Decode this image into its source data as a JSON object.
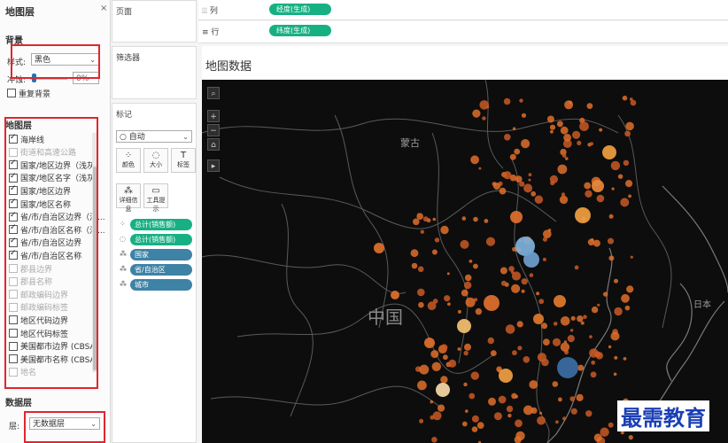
{
  "left_panel": {
    "title": "地图层",
    "close": "×",
    "background": {
      "heading": "背景",
      "style_label": "样式:",
      "style_value": "黑色",
      "wash_label": "冲蚀:",
      "wash_value": "0%",
      "repeat_label": "重复背景"
    },
    "layers": {
      "heading": "地图层",
      "items": [
        {
          "label": "海岸线",
          "checked": true,
          "enabled": true
        },
        {
          "label": "街道和高速公路",
          "checked": false,
          "enabled": false
        },
        {
          "label": "国家/地区边界（浅灰）",
          "checked": true,
          "enabled": true
        },
        {
          "label": "国家/地区名字（浅灰）",
          "checked": true,
          "enabled": true
        },
        {
          "label": "国家/地区边界",
          "checked": true,
          "enabled": true
        },
        {
          "label": "国家/地区名称",
          "checked": true,
          "enabled": true
        },
        {
          "label": "省/市/自治区边界（浅...",
          "checked": true,
          "enabled": true
        },
        {
          "label": "省/市/自治区名称（浅...",
          "checked": true,
          "enabled": true
        },
        {
          "label": "省/市/自治区边界",
          "checked": true,
          "enabled": true
        },
        {
          "label": "省/市/自治区名称",
          "checked": true,
          "enabled": true
        },
        {
          "label": "郡县边界",
          "checked": false,
          "enabled": false
        },
        {
          "label": "郡县名称",
          "checked": false,
          "enabled": false
        },
        {
          "label": "邮政编码边界",
          "checked": false,
          "enabled": false
        },
        {
          "label": "邮政编码标签",
          "checked": false,
          "enabled": false
        },
        {
          "label": "地区代码边界",
          "checked": false,
          "enabled": true
        },
        {
          "label": "地区代码标签",
          "checked": false,
          "enabled": true
        },
        {
          "label": "美国都市边界 (CBSA)",
          "checked": false,
          "enabled": true
        },
        {
          "label": "美国都市名称 (CBSA)",
          "checked": false,
          "enabled": true
        },
        {
          "label": "地名",
          "checked": false,
          "enabled": false
        }
      ]
    },
    "data_layer": {
      "heading": "数据层",
      "layer_label": "层:",
      "layer_value": "无数据层"
    }
  },
  "pages_card": {
    "title": "页面"
  },
  "filters_card": {
    "title": "筛选器"
  },
  "marks_card": {
    "title": "标记",
    "mark_type": "自动",
    "buttons": [
      {
        "label": "颜色",
        "icon": "palette-icon",
        "glyph": "⁘"
      },
      {
        "label": "大小",
        "icon": "size-icon",
        "glyph": "◌"
      },
      {
        "label": "标签",
        "icon": "label-icon",
        "glyph": "T"
      },
      {
        "label": "详细信息",
        "icon": "detail-icon",
        "glyph": "⁂"
      },
      {
        "label": "工具提示",
        "icon": "tooltip-icon",
        "glyph": "▭"
      }
    ],
    "pills": [
      {
        "label": "总计(销售额)",
        "color": "green",
        "icon": "⁘"
      },
      {
        "label": "总计(销售额)",
        "color": "green",
        "icon": "◌"
      },
      {
        "label": "国家",
        "color": "blue",
        "icon": "⁂"
      },
      {
        "label": "省/自治区",
        "color": "blue",
        "icon": "⁂"
      },
      {
        "label": "城市",
        "color": "blue",
        "icon": "⁂"
      }
    ]
  },
  "shelves": {
    "columns_label": "列",
    "columns_pill": "经度(生成)",
    "rows_label": "行",
    "rows_pill": "纬度(生成)"
  },
  "view": {
    "title": "地图数据",
    "map_labels": {
      "china": "中国",
      "mongolia": "蒙古",
      "japan": "日本"
    },
    "controls": [
      "⌕",
      "+",
      "−",
      "⌂",
      "▸"
    ]
  },
  "watermark": "最需教育",
  "colors": {
    "accent_green": "#17b083",
    "pill_blue": "#3e82a6",
    "highlight": "#e0262f",
    "map_bg": "#0d0d0d",
    "dot": "#e0702c"
  }
}
